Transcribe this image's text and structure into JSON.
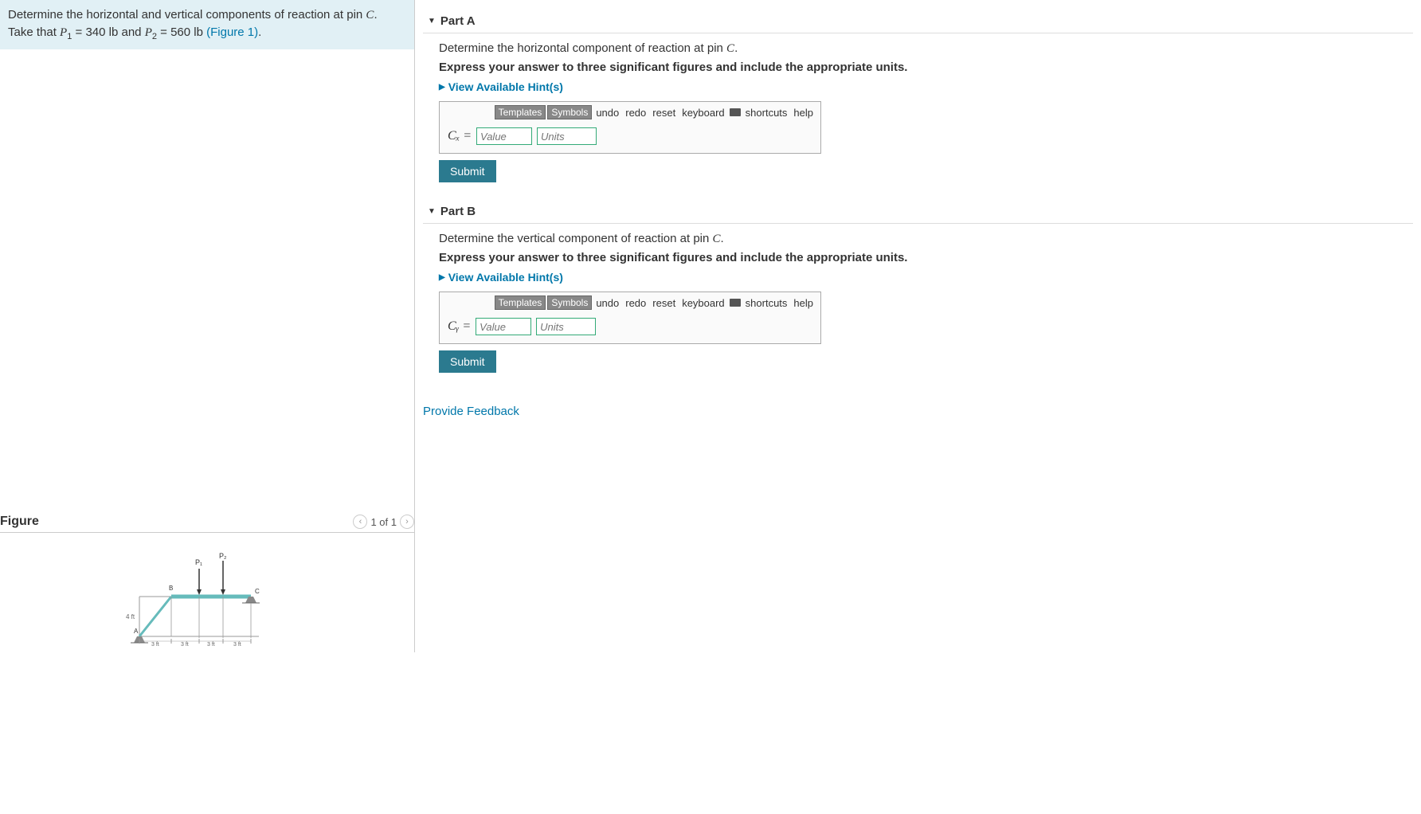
{
  "problem": {
    "line1_pre": "Determine the horizontal and vertical components of reaction at pin ",
    "line1_var": "C",
    "line1_post": ".",
    "line2_pre": "Take that ",
    "p1_var": "P",
    "p1_sub": "1",
    "p1_val": " = 340 lb",
    "and": " and ",
    "p2_var": "P",
    "p2_sub": "2",
    "p2_val": " = 560 lb ",
    "fig_link": "(Figure 1)",
    "period": "."
  },
  "figure": {
    "title": "Figure",
    "nav_text": "1 of 1"
  },
  "toolbar": {
    "templates": "Templates",
    "symbols": "Symbols",
    "undo": "undo",
    "redo": "redo",
    "reset": "reset",
    "keyboard": "keyboard",
    "shortcuts": "shortcuts",
    "help": "help"
  },
  "common": {
    "hint_text": "View Available Hint(s)",
    "value_ph": "Value",
    "units_ph": "Units",
    "submit": "Submit",
    "express": "Express your answer to three significant figures and include the appropriate units."
  },
  "partA": {
    "header": "Part A",
    "prompt_pre": "Determine the horizontal component of reaction at pin ",
    "prompt_var": "C",
    "prompt_post": ".",
    "var_label": "Cₓ ="
  },
  "partB": {
    "header": "Part B",
    "prompt_pre": "Determine the vertical component of reaction at pin ",
    "prompt_var": "C",
    "prompt_post": ".",
    "var_label": "Cᵧ ="
  },
  "feedback": "Provide Feedback",
  "diagram": {
    "p1": "P₁",
    "p2": "P₂",
    "A": "A",
    "B": "B",
    "C": "C",
    "h": "4 ft",
    "d": "3 ft"
  }
}
